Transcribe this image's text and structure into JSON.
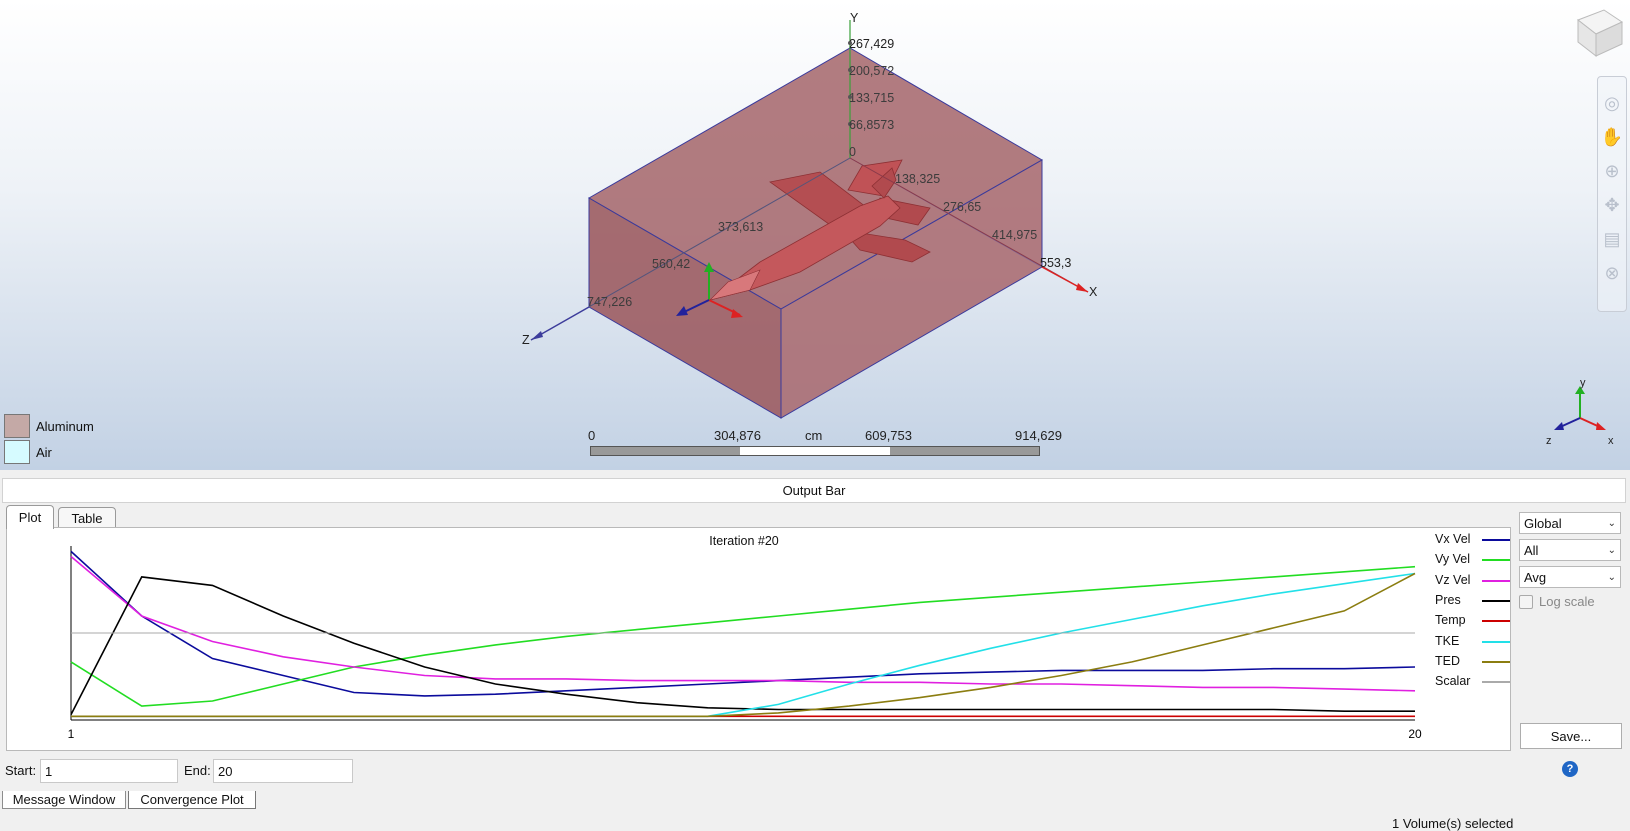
{
  "scene": {
    "axis_labels": {
      "x": "X",
      "y": "Y",
      "z": "Z"
    },
    "y_ticks": [
      "267,429",
      "200,572",
      "133,715",
      "66,8573",
      "0"
    ],
    "x_ticks": [
      "138,325",
      "276,65",
      "414,975",
      "553,3"
    ],
    "z_ticks": [
      "373,613",
      "560,42",
      "747,226"
    ]
  },
  "material_legend": [
    {
      "name": "Aluminum",
      "color": "#c4a9a6"
    },
    {
      "name": "Air",
      "color": "#d6fbff"
    }
  ],
  "scale_bar": {
    "ticks": [
      "0",
      "304,876",
      "609,753",
      "914,629"
    ],
    "unit": "cm"
  },
  "view_cube": {
    "icon": "view-cube-icon"
  },
  "nav_toolbar": {
    "icons": [
      "orbit-icon",
      "pan-hand-icon",
      "zoom-icon",
      "fit-icon",
      "section-icon",
      "close-view-icon"
    ]
  },
  "triad": {
    "x": "x",
    "y": "y",
    "z": "z"
  },
  "output_bar": {
    "title": "Output Bar"
  },
  "plot_tabs": [
    "Plot",
    "Table"
  ],
  "side_controls": {
    "scope": "Global",
    "filter": "All",
    "stat": "Avg",
    "log_scale_label": "Log scale",
    "log_scale_checked": false,
    "save_label": "Save...",
    "help_icon": "?"
  },
  "range": {
    "start_label": "Start:",
    "start_value": "1",
    "end_label": "End:",
    "end_value": "20"
  },
  "bottom_tabs": [
    "Message Window",
    "Convergence Plot"
  ],
  "status": {
    "text": "1 Volume(s) selected"
  },
  "chart_data": {
    "type": "line",
    "title": "Iteration #20",
    "x_tick_labels": [
      "1",
      "20"
    ],
    "x": [
      1,
      2,
      3,
      4,
      5,
      6,
      7,
      8,
      9,
      10,
      11,
      12,
      13,
      14,
      15,
      16,
      17,
      18,
      19,
      20
    ],
    "ylim": [
      0,
      1
    ],
    "series": [
      {
        "name": "Vx Vel",
        "color": "#0b0b9c",
        "values": [
          0.98,
          0.6,
          0.35,
          0.25,
          0.15,
          0.13,
          0.14,
          0.16,
          0.18,
          0.2,
          0.22,
          0.24,
          0.26,
          0.27,
          0.28,
          0.28,
          0.28,
          0.29,
          0.29,
          0.3
        ]
      },
      {
        "name": "Vy Vel",
        "color": "#22dd22",
        "values": [
          0.33,
          0.07,
          0.1,
          0.2,
          0.3,
          0.37,
          0.43,
          0.48,
          0.52,
          0.56,
          0.6,
          0.64,
          0.68,
          0.71,
          0.74,
          0.77,
          0.8,
          0.83,
          0.86,
          0.89
        ]
      },
      {
        "name": "Vz Vel",
        "color": "#e020e0",
        "values": [
          0.95,
          0.6,
          0.45,
          0.36,
          0.3,
          0.25,
          0.23,
          0.23,
          0.22,
          0.22,
          0.22,
          0.21,
          0.21,
          0.2,
          0.2,
          0.19,
          0.18,
          0.18,
          0.17,
          0.16
        ]
      },
      {
        "name": "Pres",
        "color": "#000000",
        "values": [
          0.02,
          0.83,
          0.78,
          0.6,
          0.44,
          0.3,
          0.2,
          0.14,
          0.09,
          0.06,
          0.05,
          0.05,
          0.05,
          0.05,
          0.05,
          0.05,
          0.05,
          0.05,
          0.04,
          0.04
        ]
      },
      {
        "name": "Temp",
        "color": "#cc0000",
        "values": [
          0.01,
          0.01,
          0.01,
          0.01,
          0.01,
          0.01,
          0.01,
          0.01,
          0.01,
          0.01,
          0.01,
          0.01,
          0.01,
          0.01,
          0.01,
          0.01,
          0.01,
          0.01,
          0.01,
          0.01
        ]
      },
      {
        "name": "TKE",
        "color": "#22e0e8",
        "values": [
          0.01,
          0.01,
          0.01,
          0.01,
          0.01,
          0.01,
          0.01,
          0.01,
          0.01,
          0.01,
          0.08,
          0.2,
          0.31,
          0.41,
          0.5,
          0.58,
          0.66,
          0.73,
          0.79,
          0.85
        ]
      },
      {
        "name": "TED",
        "color": "#8b7d10",
        "values": [
          0.01,
          0.01,
          0.01,
          0.01,
          0.01,
          0.01,
          0.01,
          0.01,
          0.01,
          0.01,
          0.03,
          0.07,
          0.12,
          0.18,
          0.25,
          0.33,
          0.43,
          0.53,
          0.63,
          0.85
        ]
      },
      {
        "name": "Scalar",
        "color": "#aaaaaa",
        "values": [
          0.5,
          0.5,
          0.5,
          0.5,
          0.5,
          0.5,
          0.5,
          0.5,
          0.5,
          0.5,
          0.5,
          0.5,
          0.5,
          0.5,
          0.5,
          0.5,
          0.5,
          0.5,
          0.5,
          0.5
        ]
      }
    ]
  }
}
